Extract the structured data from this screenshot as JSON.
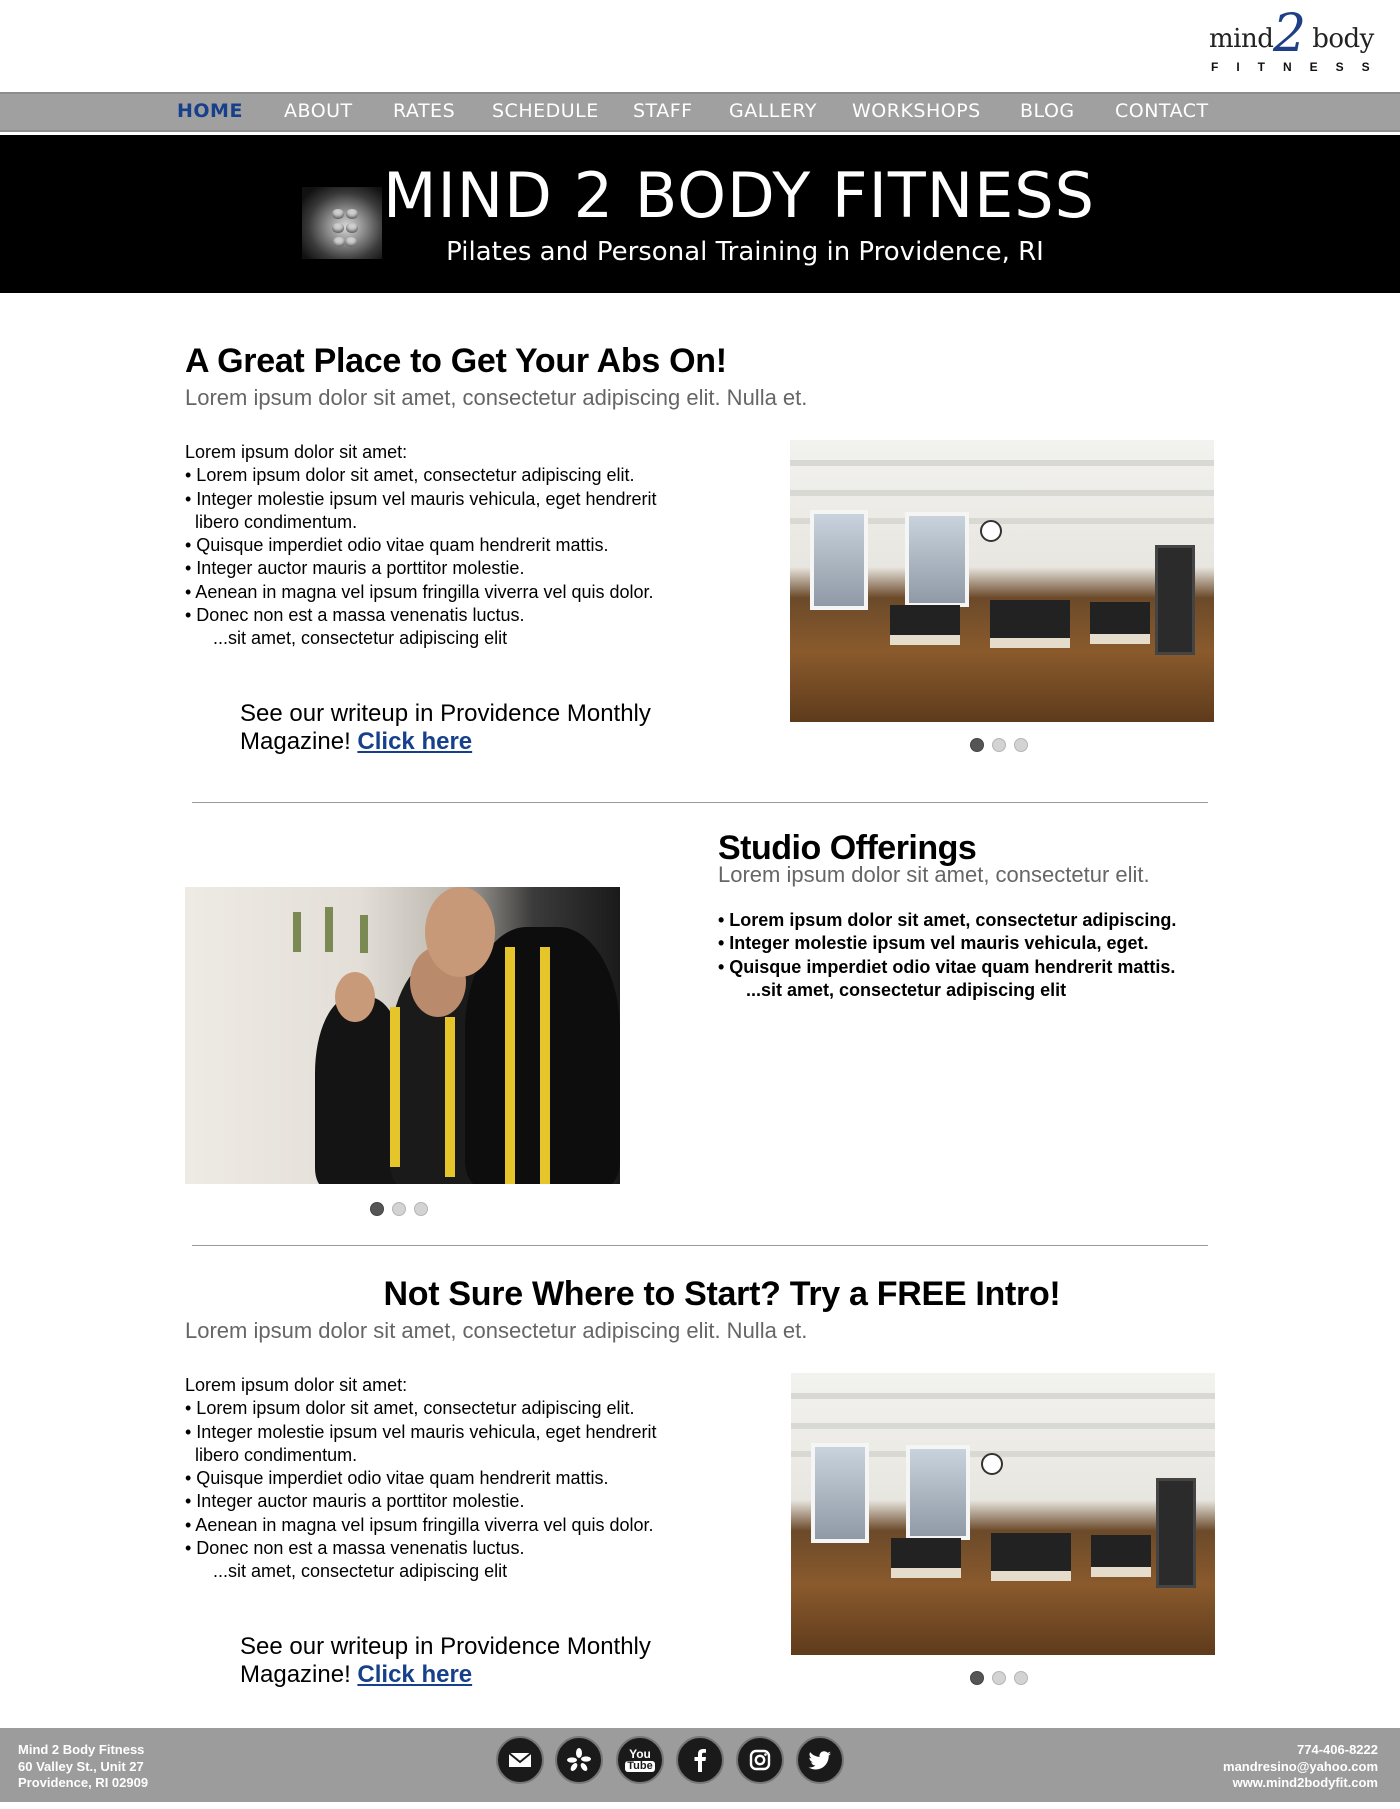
{
  "logo": {
    "text_top": "mind body",
    "numeral": "2",
    "text_sub": "FITNESS"
  },
  "nav": [
    {
      "label": "HOME",
      "active": true
    },
    {
      "label": "ABOUT"
    },
    {
      "label": "RATES"
    },
    {
      "label": "SCHEDULE"
    },
    {
      "label": "STAFF"
    },
    {
      "label": "GALLERY"
    },
    {
      "label": "WORKSHOPS"
    },
    {
      "label": "BLOG"
    },
    {
      "label": "CONTACT"
    }
  ],
  "banner": {
    "title": "MIND 2 BODY FITNESS",
    "subtitle": "Pilates and Personal Training in Providence, RI"
  },
  "section1": {
    "heading": "A Great Place to Get Your Abs On!",
    "lead": "Lorem ipsum dolor sit amet, consectetur adipiscing elit. Nulla et.",
    "lines": [
      "Lorem ipsum dolor sit amet:",
      "• Lorem ipsum dolor sit amet, consectetur adipiscing elit.",
      "• Integer molestie ipsum vel mauris vehicula, eget hendrerit",
      "libero condimentum.",
      "• Quisque imperdiet odio vitae quam hendrerit mattis.",
      "• Integer auctor mauris a porttitor molestie.",
      "• Aenean in magna vel ipsum fringilla viverra vel quis dolor.",
      "• Donec non est a massa venenatis luctus.",
      "...sit amet, consectetur adipiscing elit"
    ],
    "writeup_line1": "See our writeup in Providence Monthly",
    "writeup_line2": "Magazine!",
    "writeup_link": "Click here"
  },
  "section2": {
    "heading": "Studio Offerings",
    "lead": "Lorem ipsum dolor sit amet, consectetur elit.",
    "lines": [
      "• Lorem ipsum dolor sit amet, consectetur adipiscing.",
      "• Integer molestie ipsum vel mauris vehicula, eget.",
      "• Quisque imperdiet odio vitae quam hendrerit mattis.",
      "...sit amet, consectetur adipiscing elit"
    ]
  },
  "section3": {
    "heading": "Not Sure Where to Start?  Try a FREE Intro!",
    "lead": "Lorem ipsum dolor sit amet, consectetur adipiscing elit. Nulla et.",
    "lines": [
      "Lorem ipsum dolor sit amet:",
      "• Lorem ipsum dolor sit amet, consectetur adipiscing elit.",
      "• Integer molestie ipsum vel mauris vehicula, eget hendrerit",
      "libero condimentum.",
      "• Quisque imperdiet odio vitae quam hendrerit mattis.",
      "• Integer auctor mauris a porttitor molestie.",
      "• Aenean in magna vel ipsum fringilla viverra vel quis dolor.",
      "• Donec non est a massa venenatis luctus.",
      "...sit amet, consectetur adipiscing elit"
    ],
    "writeup_line1": "See our writeup in Providence Monthly",
    "writeup_line2": "Magazine!",
    "writeup_link": "Click here"
  },
  "carousels": {
    "slide_count": 3,
    "active_index": 0
  },
  "footer": {
    "left": [
      "Mind 2 Body Fitness",
      "60 Valley St., Unit 27",
      "Providence, RI 02909"
    ],
    "right": [
      "774-406-8222",
      "mandresino@yahoo.com",
      "www.mind2bodyfit.com"
    ],
    "social": [
      "email-icon",
      "yelp-icon",
      "youtube-icon",
      "facebook-icon",
      "instagram-icon",
      "twitter-icon"
    ],
    "youtube_text_top": "You",
    "youtube_text_bottom": "Tube"
  },
  "colors": {
    "accent": "#17408b",
    "nav_bg": "#a0a0a0",
    "banner_bg": "#000000",
    "footer_bg": "#9c9c9c"
  }
}
